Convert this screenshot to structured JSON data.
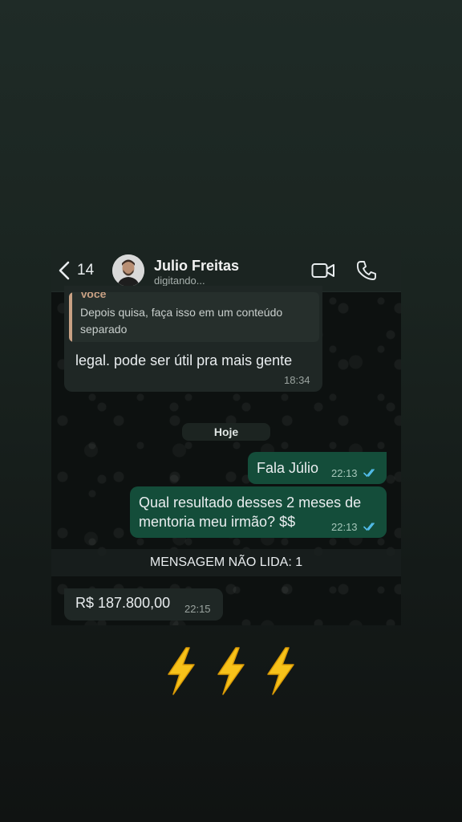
{
  "header": {
    "back_count": "14",
    "contact_name": "Julio Freitas",
    "contact_status": "digitando...",
    "icons": [
      "chevron-left-icon",
      "video-call-icon",
      "phone-icon"
    ]
  },
  "messages": {
    "reply": {
      "quote_author": "Você",
      "quote_text": "Depois quisa, faça isso em um conteúdo separado",
      "text": "legal. pode ser útil pra mais gente",
      "time": "18:34"
    },
    "date_separator": "Hoje",
    "out1": {
      "text": "Fala Júlio",
      "time": "22:13"
    },
    "out2": {
      "line1": "Qual resultado desses 2 meses de",
      "line2": "mentoria meu irmão? $$",
      "time": "22:13"
    },
    "unread_banner": "MENSAGEM NÃO LIDA: 1",
    "in2": {
      "text": "R$ 187.800,00",
      "time": "22:15"
    }
  },
  "colors": {
    "outgoing_bubble": "#144d3a",
    "incoming_bubble": "#1f2725",
    "read_ticks": "#53bdeb",
    "quote_accent": "#c9a184",
    "bolt": "#f7c21a"
  },
  "decoration": {
    "emoji": [
      "lightning-bolt",
      "lightning-bolt",
      "lightning-bolt"
    ]
  }
}
